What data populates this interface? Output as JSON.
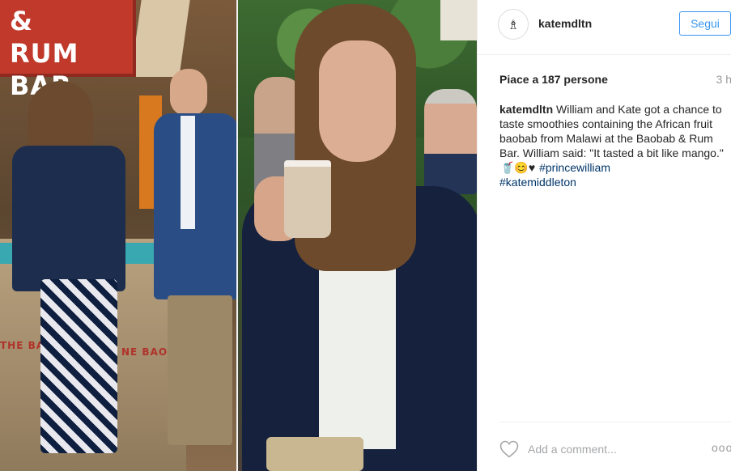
{
  "photo": {
    "left_sign_lines": [
      "BAOBAB &",
      "RUM BAR"
    ],
    "bar_side_text_1": "THE BAOB",
    "bar_side_text_2": "NE BAOBAB CANE"
  },
  "header": {
    "avatar_glyph": "♗",
    "username": "katemdltn",
    "follow_label": "Segui"
  },
  "stats": {
    "likes_text": "Piace a 187 persone",
    "time_ago": "3 h"
  },
  "caption": {
    "username": "katemdltn",
    "text": "William and Kate got a chance to taste smoothies containing the African fruit baobab from Malawi at the Baobab & Rum Bar. William said: \"It tasted a bit like mango.\"",
    "emojis": "🥤😊♥",
    "hashtags": [
      "#princewilliam",
      "#katemiddleton"
    ]
  },
  "comment": {
    "placeholder": "Add a comment...",
    "more_glyph": "ooo"
  },
  "colors": {
    "accent": "#3897f0",
    "hashtag": "#003569",
    "muted": "#999999",
    "sign_red": "#c0392b"
  },
  "icons": {
    "like": "heart-outline-icon",
    "more": "more-options-icon"
  }
}
